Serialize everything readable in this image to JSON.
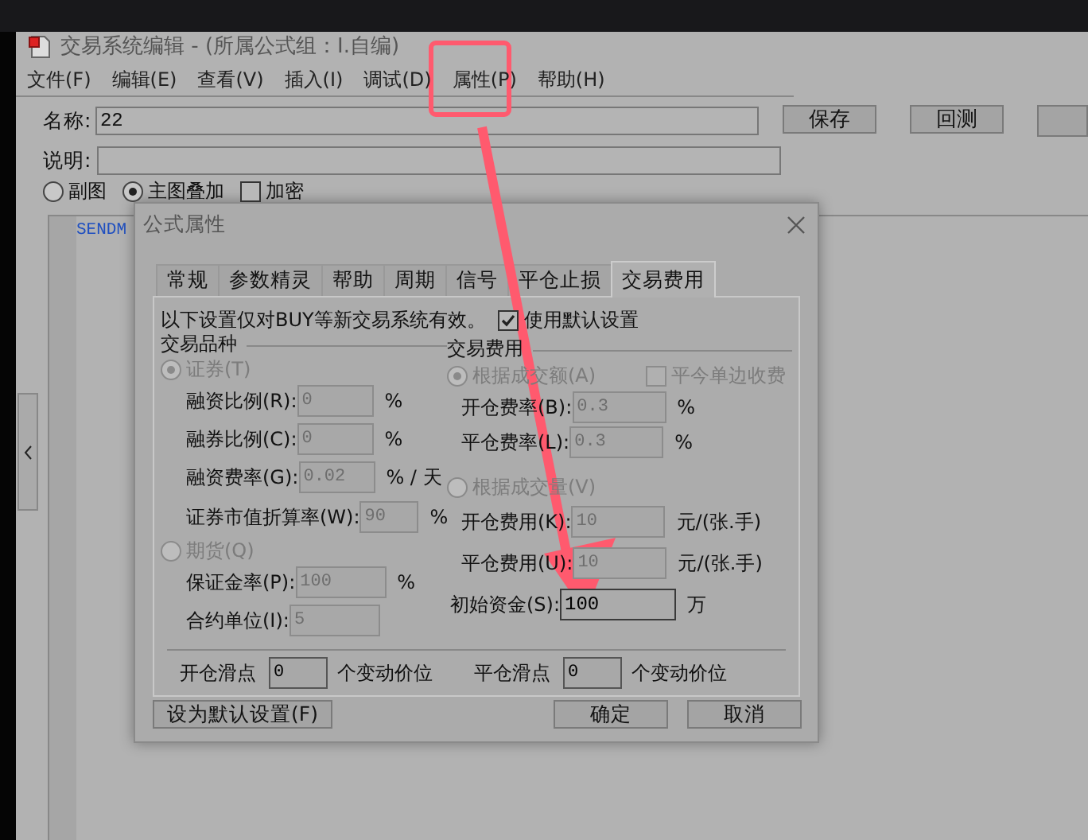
{
  "window": {
    "title": "交易系统编辑 - (所属公式组：I.自编)",
    "menu": [
      {
        "label": "文件(F)"
      },
      {
        "label": "编辑(E)"
      },
      {
        "label": "查看(V)"
      },
      {
        "label": "插入(I)"
      },
      {
        "label": "调试(D)"
      },
      {
        "label": "属性(P)"
      },
      {
        "label": "帮助(H)"
      }
    ],
    "name_field": {
      "label": "名称:",
      "value": "22"
    },
    "description_field": {
      "label": "说明:"
    },
    "buttons": [
      {
        "label": "保存"
      },
      {
        "label": "回测"
      }
    ],
    "chart_options": [
      {
        "kind": "radio",
        "label": "副图",
        "selected": false
      },
      {
        "kind": "radio",
        "label": "主图叠加",
        "selected": true
      },
      {
        "kind": "checkbox",
        "label": "加密",
        "checked": false
      }
    ],
    "editor": {
      "code": "SENDM"
    }
  },
  "dialog": {
    "title": "公式属性",
    "tabs": [
      {
        "label": "常规",
        "selected": false
      },
      {
        "label": "参数精灵",
        "selected": false
      },
      {
        "label": "帮助",
        "selected": false
      },
      {
        "label": "周期",
        "selected": false
      },
      {
        "label": "信号",
        "selected": false
      },
      {
        "label": "平仓止损",
        "selected": false
      },
      {
        "label": "交易费用",
        "selected": true
      }
    ],
    "note": "以下设置仅对BUY等新交易系统有效。",
    "use_default": {
      "label": "使用默认设置",
      "checked": true
    },
    "instrument_group": {
      "title": "交易品种",
      "securities": {
        "label": "证券(T)",
        "selected": true,
        "disabled": true
      },
      "securities_fields": [
        {
          "label": "融资比例(R):",
          "value": "0",
          "unit": "%",
          "disabled": true
        },
        {
          "label": "融券比例(C):",
          "value": "0",
          "unit": "%",
          "disabled": true
        },
        {
          "label": "融资费率(G):",
          "value": "0.02",
          "unit": "% / 天",
          "disabled": true
        },
        {
          "label": "证券市值折算率(W):",
          "value": "90",
          "unit": "%",
          "disabled": true
        }
      ],
      "futures": {
        "label": "期货(Q)",
        "selected": false,
        "disabled": true
      },
      "futures_fields": [
        {
          "label": "保证金率(P):",
          "value": "100",
          "unit": "%",
          "disabled": true
        },
        {
          "label": "合约单位(I):",
          "value": "5",
          "disabled": true
        }
      ]
    },
    "fee_group": {
      "title": "交易费用",
      "by_amount": {
        "label": "根据成交额(A)",
        "selected": true,
        "disabled": true
      },
      "same_day_single": {
        "label": "平今单边收费",
        "checked": false,
        "disabled": true
      },
      "amount_fields": [
        {
          "label": "开仓费率(B):",
          "value": "0.3",
          "unit": "%",
          "disabled": true
        },
        {
          "label": "平仓费率(L):",
          "value": "0.3",
          "unit": "%",
          "disabled": true
        }
      ],
      "by_volume": {
        "label": "根据成交量(V)",
        "selected": false,
        "disabled": true
      },
      "volume_fields": [
        {
          "label": "开仓费用(K):",
          "value": "10",
          "unit": "元/(张.手)",
          "disabled": true
        },
        {
          "label": "平仓费用(U):",
          "value": "10",
          "unit": "元/(张.手)",
          "disabled": true
        },
        {
          "label": "初始资金(S):",
          "value": "100",
          "unit": "万",
          "disabled": false
        }
      ]
    },
    "slippage": [
      {
        "label": "开仓滑点",
        "value": "0",
        "unit": "个变动价位"
      },
      {
        "label": "平仓滑点",
        "value": "0",
        "unit": "个变动价位"
      }
    ],
    "buttons": [
      {
        "label": "设为默认设置(F)"
      },
      {
        "label": "确定"
      },
      {
        "label": "取消"
      }
    ]
  }
}
